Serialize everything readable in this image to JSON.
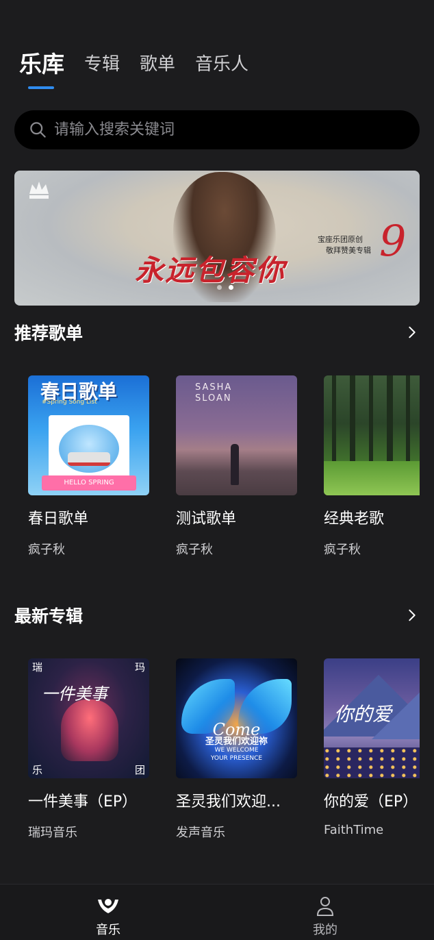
{
  "tabs": [
    {
      "label": "乐库"
    },
    {
      "label": "专辑"
    },
    {
      "label": "歌单"
    },
    {
      "label": "音乐人"
    }
  ],
  "search": {
    "placeholder": "请输入搜索关键词"
  },
  "banner": {
    "title": "永远包容你",
    "subtitle_line1": "宝座乐团原创",
    "subtitle_line2": "敬拜赞美专辑",
    "number": "9",
    "active_dot": 1
  },
  "recommended_playlists": {
    "title": "推荐歌单",
    "items": [
      {
        "name": "春日歌单",
        "author": "疯子秋",
        "cover_text": "春日歌单",
        "cover_subtext": "HELLO SPRING",
        "cover_heading": "#Spring Song List"
      },
      {
        "name": "测试歌单",
        "author": "疯子秋",
        "cover_text_line1": "SASHA",
        "cover_text_line2": "SLOAN"
      },
      {
        "name": "经典老歌",
        "author": "疯子秋"
      }
    ]
  },
  "latest_albums": {
    "title": "最新专辑",
    "items": [
      {
        "name": "一件美事（EP）",
        "author": "瑞玛音乐",
        "cover_script": "一件美事",
        "cover_corners": [
          "瑞",
          "玛",
          "乐",
          "团"
        ]
      },
      {
        "name": "圣灵我们欢迎...",
        "author": "发声音乐",
        "cover_script": "Come",
        "cover_title": "圣灵我们欢迎祢",
        "cover_sub_line1": "WE WELCOME",
        "cover_sub_line2": "YOUR PRESENCE"
      },
      {
        "name": "你的爱（EP）",
        "author": "FaithTime",
        "cover_script": "你的爱"
      }
    ]
  },
  "bottom_nav": [
    {
      "label": "音乐",
      "icon": "music-person-icon",
      "active": true
    },
    {
      "label": "我的",
      "icon": "user-icon",
      "active": false
    }
  ],
  "colors": {
    "background": "#1c1c1e",
    "accent": "#2f8cf0",
    "banner_red": "#c8232c"
  }
}
